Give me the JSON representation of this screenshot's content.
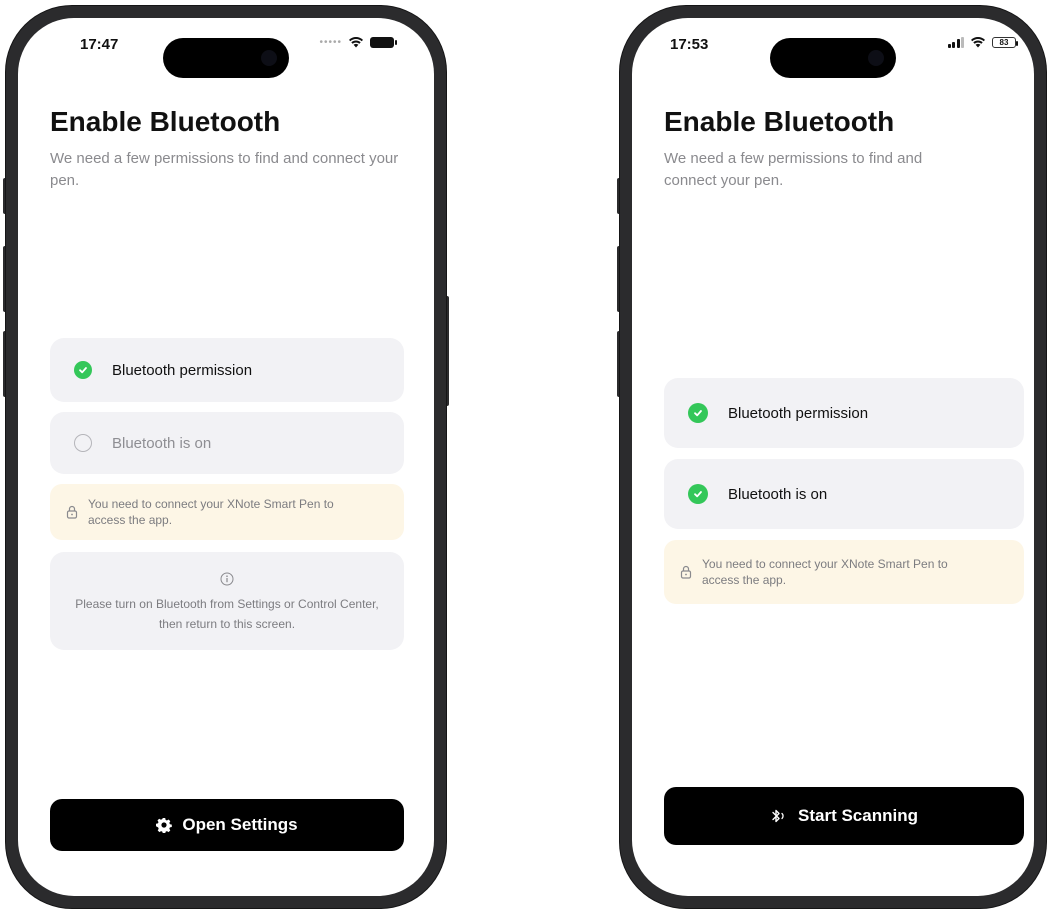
{
  "left_screen": {
    "status_time": "17:47",
    "title": "Enable Bluetooth",
    "subtitle": "We need a few permissions to find and connect your pen.",
    "checklist": [
      {
        "label": "Bluetooth permission",
        "checked": true
      },
      {
        "label": "Bluetooth is on",
        "checked": false
      }
    ],
    "notice": "You need to connect your XNote Smart Pen to access the app.",
    "info": "Please turn on Bluetooth from Settings or Control Center, then return to this screen.",
    "button_label": "Open Settings",
    "button_icon": "gear-icon"
  },
  "right_screen": {
    "status_time": "17:53",
    "battery_level": "83",
    "title": "Enable Bluetooth",
    "subtitle": "We need a few permissions to find and connect your pen.",
    "checklist": [
      {
        "label": "Bluetooth permission",
        "checked": true
      },
      {
        "label": "Bluetooth is on",
        "checked": true
      }
    ],
    "notice": "You need to connect your XNote Smart Pen to access the app.",
    "button_label": "Start Scanning",
    "button_icon": "bluetooth-scan-icon"
  },
  "colors": {
    "success": "#34c759",
    "notice_bg": "#fdf6e6",
    "card_bg": "#f2f2f5",
    "button_bg": "#000000"
  }
}
